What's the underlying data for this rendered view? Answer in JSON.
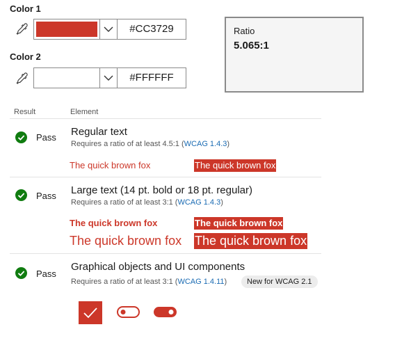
{
  "color1": {
    "label": "Color 1",
    "hex": "#CC3729",
    "swatch": "#CC3729"
  },
  "color2": {
    "label": "Color 2",
    "hex": "#FFFFFF",
    "swatch": "#FFFFFF"
  },
  "ratio": {
    "label": "Ratio",
    "value": "5.065:1"
  },
  "headers": {
    "result": "Result",
    "element": "Element"
  },
  "rows": [
    {
      "status": "Pass",
      "title": "Regular text",
      "req_prefix": "Requires a ratio of at least 4.5:1 (",
      "link": "WCAG 1.4.3",
      "req_suffix": ")",
      "sample1": "The quick brown fox",
      "sample2": "The quick brown fox"
    },
    {
      "status": "Pass",
      "title": "Large text (14 pt. bold or 18 pt. regular)",
      "req_prefix": "Requires a ratio of at least 3:1 (",
      "link": "WCAG 1.4.3",
      "req_suffix": ")",
      "sample_bold1": "The quick brown fox",
      "sample_bold2": "The quick brown fox",
      "sample_large1": "The quick brown fox",
      "sample_large2": "The quick brown fox"
    },
    {
      "status": "Pass",
      "title": "Graphical objects and UI components",
      "req_prefix": "Requires a ratio of at least 3:1 (",
      "link": "WCAG 1.4.11",
      "req_suffix": ")",
      "badge": "New for WCAG 2.1"
    }
  ],
  "colors": {
    "accent": "#CC3729",
    "pass": "#107c10",
    "link": "#1a6bb3"
  },
  "icons": [
    "eyedropper-icon",
    "chevron-down-icon",
    "check-circle-icon",
    "checkbox-checked-icon",
    "toggle-off-icon",
    "toggle-on-icon"
  ]
}
